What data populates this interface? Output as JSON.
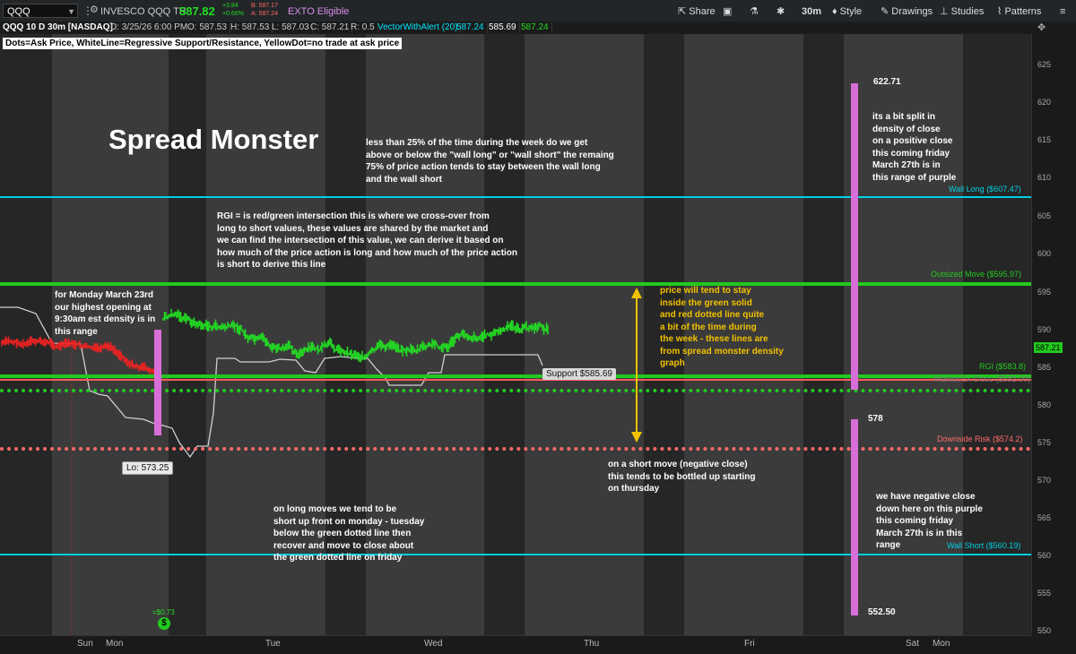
{
  "toolbar": {
    "symbol": "QQQ",
    "description": "INVESCO QQQ TR",
    "last": "587.82",
    "change": "+3.84",
    "change_pct": "+0.66%",
    "bid": "B: 587.17",
    "ask": "A: 587.24",
    "exto": "EXTO Eligible",
    "share": "Share",
    "timeframe": "30m",
    "style": "Style",
    "drawings": "Drawings",
    "studies": "Studies",
    "patterns": "Patterns"
  },
  "infobar": {
    "chart_name": "QQQ 10 D 30m [NASDAQ]",
    "date": "D: 3/25/26 6:00 PM",
    "open": "O: 587.53",
    "high": "H: 587.53",
    "low": "L: 587.03",
    "close": "C: 587.21",
    "range": "R: 0.5",
    "study": "VectorWithAlert (20)",
    "v1": "587.24",
    "v2": "585.69",
    "v3": "587.24"
  },
  "legend_note": "Dots=Ask Price, WhiteLine=Regressive Support/Resistance, YellowDot=no trade at ask price",
  "headline": "Spread Monster",
  "levels": {
    "wall_long": "Wall Long  ($607.47)",
    "outsized": "Outsized Move ($595.97)",
    "rgi": "RGI ($583.8)",
    "hidden": "Market Ex Close ($582.00)",
    "downside": "Downside Risk ($574.2)",
    "wall_short": "Wall Short  ($560.19)"
  },
  "price_tag": "587.21",
  "support_tag": "Support $585.69",
  "low_tag": "Lo: 573.25",
  "small_tag": "=$0.73",
  "purple_top": "622.71",
  "purple_mid": "578",
  "purple_bottom": "552.50",
  "annotations": {
    "wall_note": [
      "less than 25% of the time during the week do we get",
      "above or below the \"wall long\" or \"wall short\" the remaing",
      "75% of price action tends to stay between the wall long",
      "and the wall short"
    ],
    "rgi_note": [
      "RGI = is red/green intersection this is where we cross-over from",
      "long to short values, these values are shared by the market and",
      "we can find the intersection of this value, we can derive it based on",
      "how much of the price action is long and how much of the price action",
      "is short to derive this line"
    ],
    "monday_note": [
      "for Monday March 23rd",
      "our highest opening at",
      "9:30am est density is in",
      "this range"
    ],
    "green_note": [
      "price will tend to stay",
      "inside the green solid",
      "and red dotted line quite",
      "a bit of the time during",
      "the week - these lines are",
      "from spread monster density",
      "graph"
    ],
    "split_note": [
      "its a bit split in",
      "density of close",
      "on a positive close",
      "this coming friday",
      "March 27th is in",
      "this range of purple"
    ],
    "short_move_note": [
      "on a short move (negative close)",
      "this tends to be bottled up starting",
      "on thursday"
    ],
    "long_moves_note": [
      "on long moves we tend to be",
      "short up front on monday - tuesday",
      "below the green dotted line then",
      "recover and move to close about",
      "the green dotted line on friday"
    ],
    "negative_note": [
      "we have negative close",
      "down here on this purple",
      "this coming friday",
      "March 27th is in this",
      "range"
    ]
  },
  "y_ticks": [
    "625",
    "620",
    "615",
    "610",
    "605",
    "600",
    "595",
    "590",
    "585",
    "580",
    "575",
    "570",
    "565",
    "560",
    "555",
    "550"
  ],
  "x_ticks": [
    "Sun",
    "Mon",
    "Tue",
    "Wed",
    "Thu",
    "Fri",
    "Sat",
    "Mon"
  ],
  "colors": {
    "wall": "#00d0e0",
    "outsized": "#22c91e",
    "rgi": "#22c91e",
    "downside": "#ff5555",
    "purple": "#d86ed8",
    "gold": "#f2c200",
    "up": "#22dd22",
    "down": "#ee2222"
  }
}
